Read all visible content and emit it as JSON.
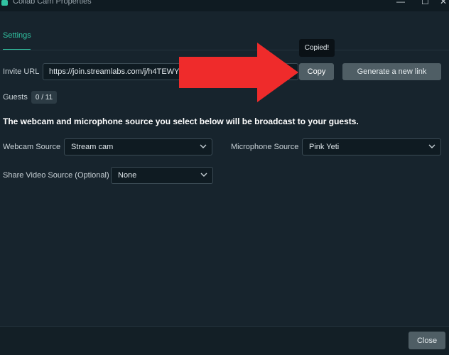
{
  "window": {
    "title": "Collab Cam Properties",
    "minimize_glyph": "—",
    "maximize_glyph": "☐",
    "close_glyph": "✕"
  },
  "tabs": {
    "settings_label": "Settings"
  },
  "invite": {
    "label": "Invite URL",
    "url": "https://join.streamlabs.com/j/h4TEWY",
    "copy_label": "Copy",
    "copied_tooltip": "Copied!",
    "generate_label": "Generate a new link"
  },
  "guests": {
    "label": "Guests",
    "count": "0 / 11"
  },
  "heading": "The webcam and microphone source you select below will be broadcast to your guests.",
  "webcam": {
    "label": "Webcam Source",
    "value": "Stream cam"
  },
  "microphone": {
    "label": "Microphone Source",
    "value": "Pink Yeti"
  },
  "share_video": {
    "label": "Share Video Source (Optional)",
    "value": "None"
  },
  "footer": {
    "close_label": "Close"
  },
  "colors": {
    "accent": "#31c3a2",
    "arrow": "#ef2b2b",
    "background": "#17242d"
  }
}
